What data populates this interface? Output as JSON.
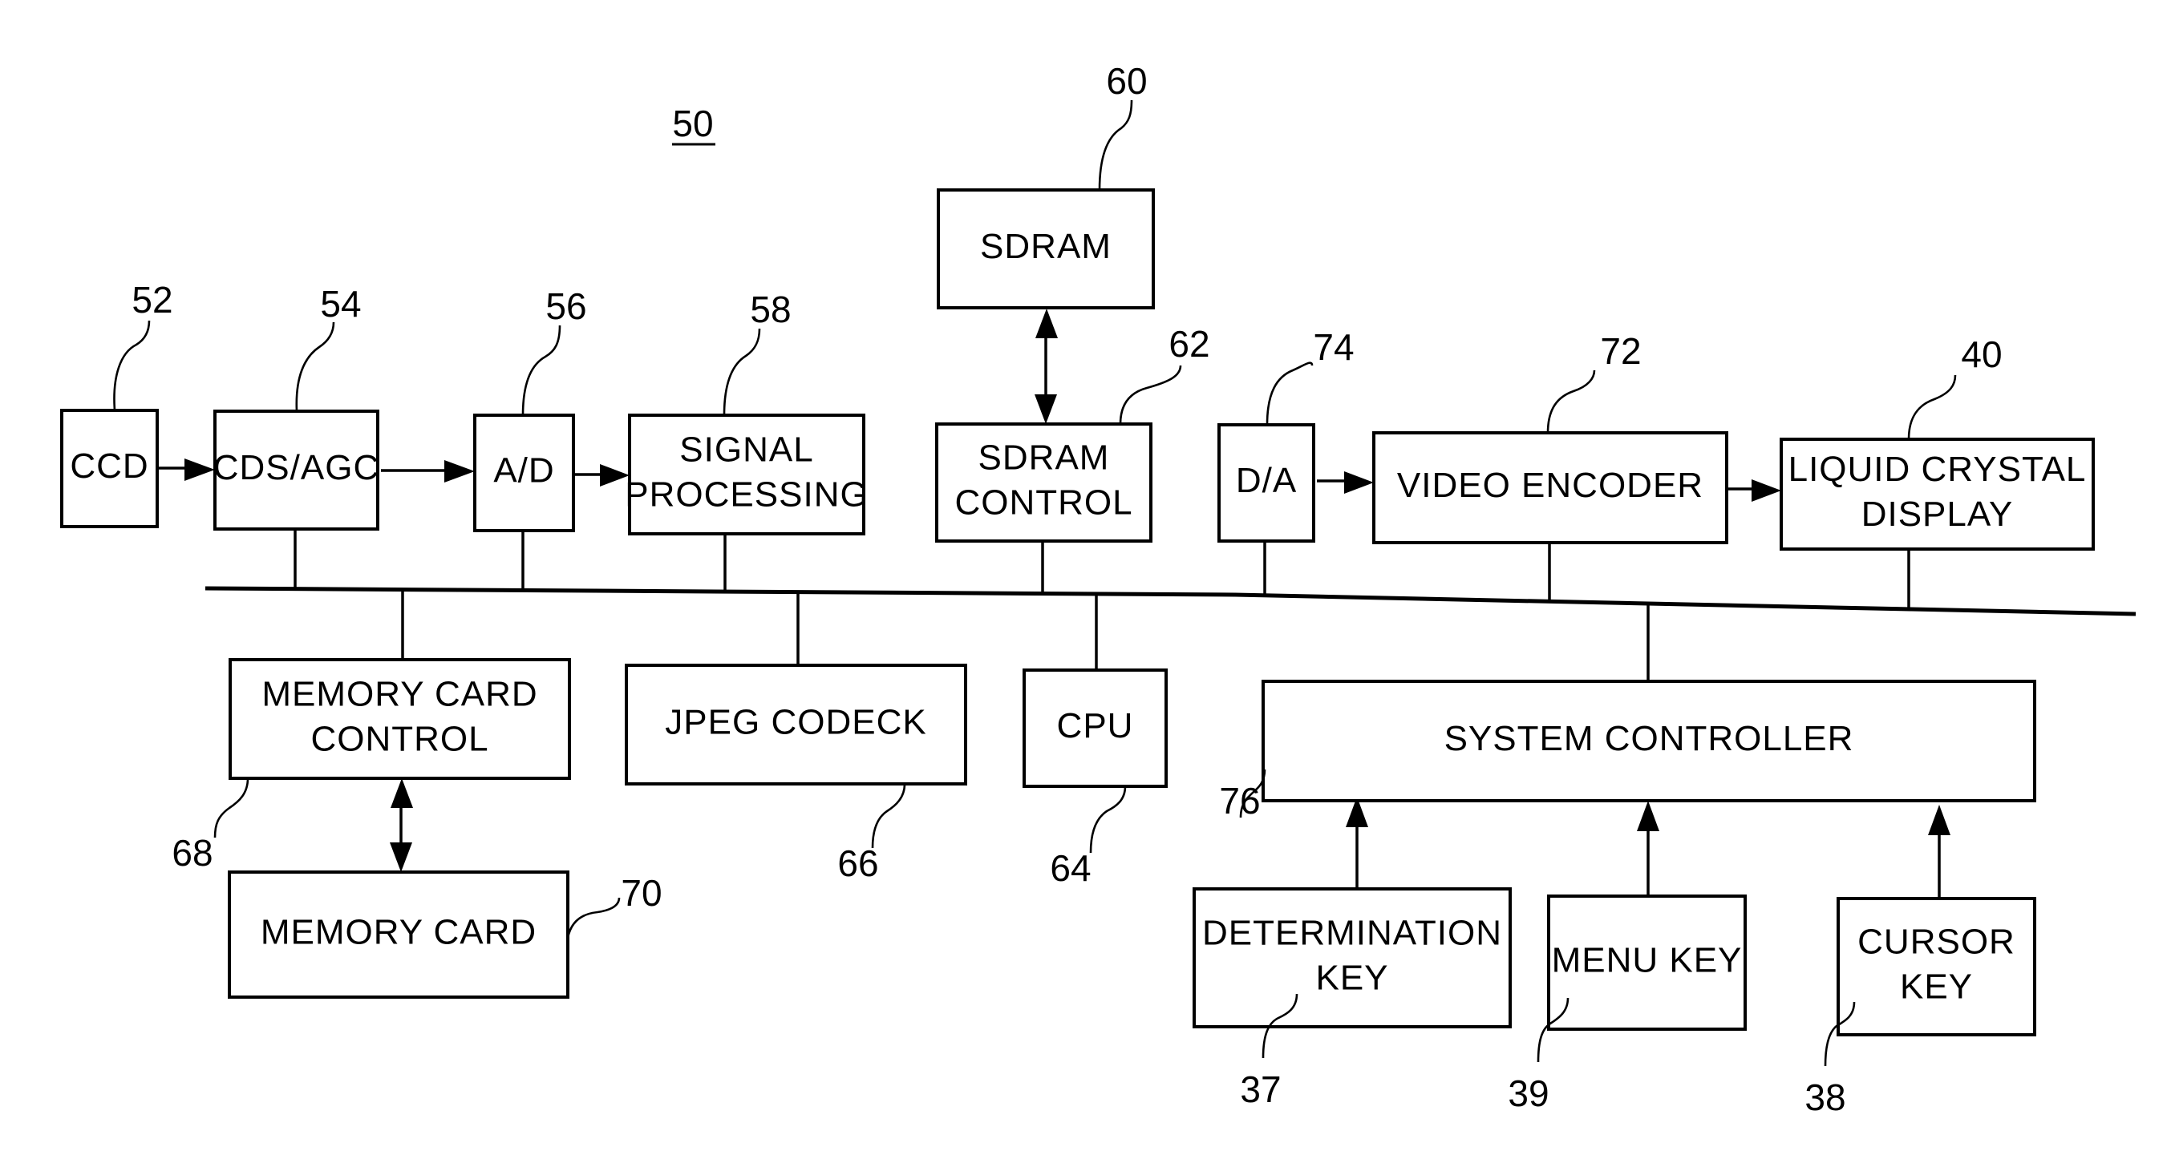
{
  "figure": {
    "reference": "50",
    "blocks": [
      {
        "id": "ccd",
        "ref": "52",
        "lines": [
          "CCD"
        ]
      },
      {
        "id": "cds-agc",
        "ref": "54",
        "lines": [
          "CDS/AGC"
        ]
      },
      {
        "id": "a-d",
        "ref": "56",
        "lines": [
          "A/D"
        ]
      },
      {
        "id": "signal-processing",
        "ref": "58",
        "lines": [
          "SIGNAL",
          "PROCESSING"
        ]
      },
      {
        "id": "sdram",
        "ref": "60",
        "lines": [
          "SDRAM"
        ]
      },
      {
        "id": "sdram-control",
        "ref": "62",
        "lines": [
          "SDRAM",
          "CONTROL"
        ]
      },
      {
        "id": "d-a",
        "ref": "74",
        "lines": [
          "D/A"
        ]
      },
      {
        "id": "video-encoder",
        "ref": "72",
        "lines": [
          "VIDEO ENCODER"
        ]
      },
      {
        "id": "liquid-crystal-display",
        "ref": "40",
        "lines": [
          "LIQUID CRYSTAL",
          "DISPLAY"
        ]
      },
      {
        "id": "memory-card-control",
        "ref": "68",
        "lines": [
          "MEMORY CARD",
          "CONTROL"
        ]
      },
      {
        "id": "jpeg-codeck",
        "ref": "66",
        "lines": [
          "JPEG CODECK"
        ]
      },
      {
        "id": "cpu",
        "ref": "64",
        "lines": [
          "CPU"
        ]
      },
      {
        "id": "system-controller",
        "ref": "76",
        "lines": [
          "SYSTEM CONTROLLER"
        ]
      },
      {
        "id": "memory-card",
        "ref": "70",
        "lines": [
          "MEMORY CARD"
        ]
      },
      {
        "id": "determination-key",
        "ref": "37",
        "lines": [
          "DETERMINATION",
          "KEY"
        ]
      },
      {
        "id": "menu-key",
        "ref": "39",
        "lines": [
          "MENU KEY"
        ]
      },
      {
        "id": "cursor-key",
        "ref": "38",
        "lines": [
          "CURSOR",
          "KEY"
        ]
      }
    ],
    "connections": [
      {
        "from": "ccd",
        "to": "cds-agc",
        "type": "arrow"
      },
      {
        "from": "cds-agc",
        "to": "a-d",
        "type": "arrow"
      },
      {
        "from": "a-d",
        "to": "signal-processing",
        "type": "arrow"
      },
      {
        "from": "sdram",
        "to": "sdram-control",
        "type": "bidirectional"
      },
      {
        "from": "d-a",
        "to": "video-encoder",
        "type": "arrow"
      },
      {
        "from": "video-encoder",
        "to": "liquid-crystal-display",
        "type": "arrow"
      },
      {
        "from": "memory-card-control",
        "to": "memory-card",
        "type": "bidirectional"
      },
      {
        "from": "determination-key",
        "to": "system-controller",
        "type": "arrow"
      },
      {
        "from": "menu-key",
        "to": "system-controller",
        "type": "arrow"
      },
      {
        "from": "cursor-key",
        "to": "system-controller",
        "type": "arrow"
      },
      {
        "from": "bus",
        "to": [
          "cds-agc",
          "a-d",
          "signal-processing",
          "sdram-control",
          "d-a",
          "video-encoder",
          "liquid-crystal-display",
          "memory-card-control",
          "jpeg-codeck",
          "cpu",
          "system-controller"
        ],
        "type": "bus"
      }
    ]
  }
}
